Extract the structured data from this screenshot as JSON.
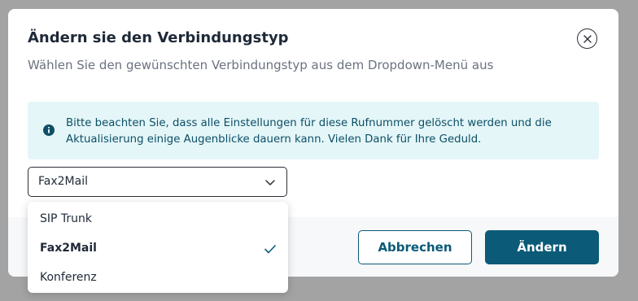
{
  "dialog": {
    "title": "Ändern sie den Verbindungstyp",
    "subtitle": "Wählen Sie den gewünschten Verbindungstyp aus dem Dropdown-Menü aus",
    "info_text": "Bitte beachten Sie, dass alle Einstellungen für diese Rufnummer gelöscht werden und die Aktualisierung einige Augenblicke dauern kann. Vielen Dank für Ihre Geduld.",
    "select_value": "Fax2Mail",
    "cancel_label": "Abbrechen",
    "confirm_label": "Ändern",
    "dropdown_options": [
      {
        "label": "SIP Trunk",
        "selected": false
      },
      {
        "label": "Fax2Mail",
        "selected": true
      },
      {
        "label": "Konferenz",
        "selected": false
      }
    ]
  },
  "colors": {
    "primary": "#0b5a78",
    "info_background": "#e4f6f8",
    "info_text": "#0d4f66",
    "overlay": "#a3a3a3"
  },
  "icons": {
    "close": "close-icon",
    "info": "info-icon",
    "chevron": "chevron-down-icon",
    "check": "check-icon"
  }
}
